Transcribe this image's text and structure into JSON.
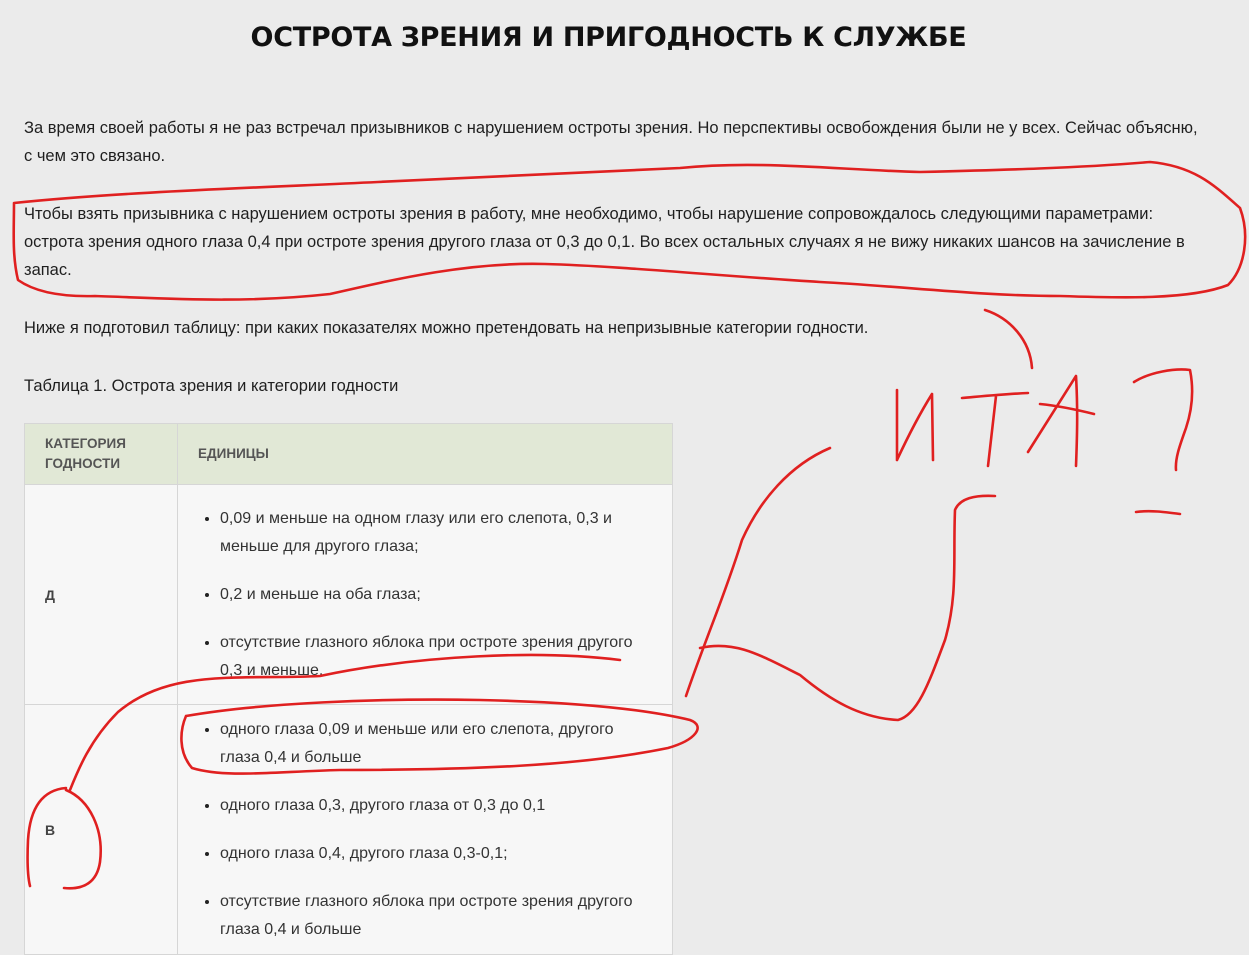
{
  "article": {
    "title": "ОСТРОТА ЗРЕНИЯ И ПРИГОДНОСТЬ К СЛУЖБЕ",
    "paragraphs": [
      "За время своей работы я не раз встречал призывников с нарушением остроты зрения. Но перспективы освобождения были не у всех. Сейчас объясню, с чем это связано.",
      "Чтобы взять призывника с нарушением остроты зрения в работу, мне необходимо, чтобы нарушение сопровождалось следующими параметрами: острота зрения одного глаза 0,4 при остроте зрения другого глаза от 0,3 до 0,1. Во всех остальных случаях я не вижу никаких шансов на зачисление в запас.",
      "Ниже я подготовил таблицу: при каких показателях можно претендовать на непризывные категории годности."
    ],
    "table_caption": "Таблица 1. Острота зрения и категории годности"
  },
  "table": {
    "headers": [
      "КАТЕГОРИЯ ГОДНОСТИ",
      "ЕДИНИЦЫ"
    ],
    "rows": [
      {
        "category": "Д",
        "items": [
          "0,09 и меньше на одном глазу или его слепота, 0,3 и меньше для другого глаза;",
          "0,2 и меньше на оба глаза;",
          "отсутствие глазного яблока при остроте зрения другого 0,3 и меньше."
        ]
      },
      {
        "category": "В",
        "items": [
          "одного глаза 0,09 и меньше или его слепота, другого глаза 0,4 и больше",
          "одного глаза 0,3, другого глаза от 0,3 до 0,1",
          "одного глаза 0,4, другого глаза 0,3-0,1;",
          "отсутствие глазного яблока при остроте зрения другого глаза 0,4 и больше"
        ]
      }
    ]
  },
  "annotation": {
    "handwritten_text": "ИТА ?",
    "ink_color": "#e02020"
  }
}
